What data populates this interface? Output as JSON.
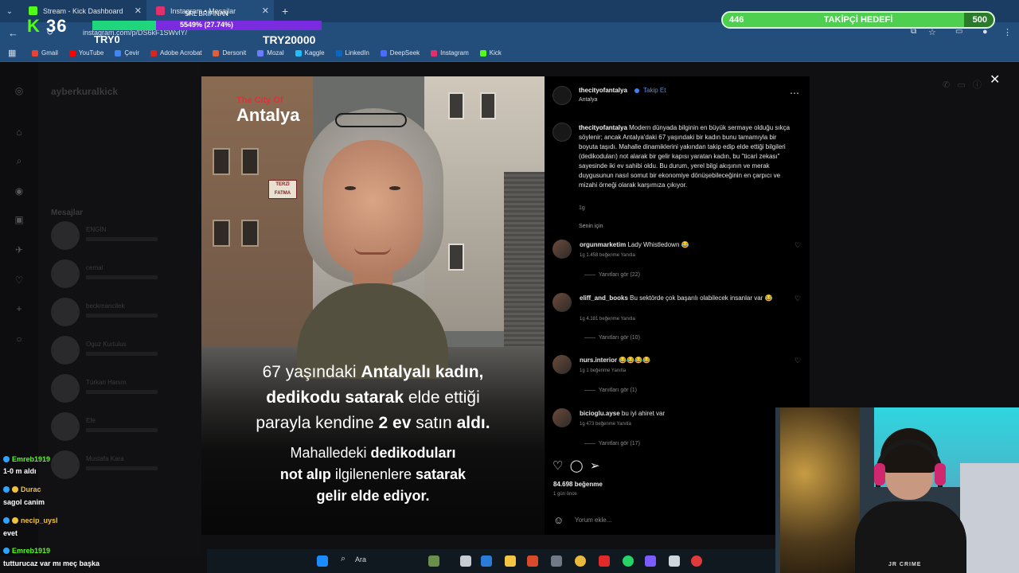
{
  "browser": {
    "tabs": [
      {
        "label": "Stream - Kick Dashboard",
        "icon": "kick-icon",
        "color": "#53fc18"
      },
      {
        "label": "Instagram • Mesajlar",
        "icon": "instagram-icon",
        "color": "#e1306c"
      }
    ],
    "url": "instagram.com/p/DS6kF1SWvlY/",
    "bookmarks": [
      {
        "label": "Gmail",
        "color": "#ea4335"
      },
      {
        "label": "YouTube",
        "color": "#ff0000"
      },
      {
        "label": "Çevir",
        "color": "#4285f4"
      },
      {
        "label": "Adobe Acrobat",
        "color": "#d7261f"
      },
      {
        "label": "Dersonit",
        "color": "#e35d3a"
      },
      {
        "label": "Mozal",
        "color": "#6b7cff"
      },
      {
        "label": "Kaggle",
        "color": "#20beff"
      },
      {
        "label": "LinkedIn",
        "color": "#0a66c2"
      },
      {
        "label": "DeepSeek",
        "color": "#4d6bfe"
      },
      {
        "label": "Instagram",
        "color": "#e1306c"
      },
      {
        "label": "Kick",
        "color": "#53fc18"
      }
    ]
  },
  "overlay": {
    "kick_count": "36",
    "try_label": "TRY0",
    "try_goal": "TRY20000",
    "progress_title": "SRL BRİFINAN",
    "progress_text": "5549% (27.74%)",
    "progress_fraction": 0.2774,
    "follower_goal": {
      "current": "446",
      "label": "TAKİPÇİ HEDEFİ",
      "target": "500",
      "fraction": 0.892
    }
  },
  "dm_panel": {
    "username": "ayberkuralkick",
    "section": "Mesajlar",
    "rows": [
      "ENGİN",
      "cemal",
      "beckmancilek",
      "Oguz Kurtulus",
      "Türkan Hanım",
      "Efe",
      "Mustafa Kara"
    ]
  },
  "post": {
    "brand_small": "The City Of",
    "brand_name": "Antalya",
    "sign_red": "",
    "sign_white": "TERZİ FATMA",
    "caption": {
      "l1a": "67 yaşındaki ",
      "l1b": "Antalyalı kadın,",
      "l2a": "dedikodu satarak",
      "l2b": " elde ettiği",
      "l3a": "parayla kendine ",
      "l3b": "2 ev",
      "l3c": " satın ",
      "l3d": "aldı.",
      "l4a": "Mahalledeki ",
      "l4b": "dedikoduları",
      "l5a": "not alıp",
      "l5b": " ilgilenenlere ",
      "l5c": "satarak",
      "l6": "gelir elde ediyor."
    }
  },
  "panel": {
    "account": "thecityofantalya",
    "follow": "Takip Et",
    "location": "Antalya",
    "caption_user": "thecityofantalya",
    "caption_text": "Modern dünyada bilginin en büyük sermaye olduğu sıkça söylenir; ancak Antalya'daki 67 yaşındaki bir kadın bunu tamamıyla bir boyuta taşıdı. Mahalle dinamiklerini yakından takip edip elde ettiği bilgileri (dedikoduları) not alarak bir gelir kapısı yaratan kadın, bu \"ticari zekası\" sayesinde iki ev sahibi oldu. Bu durum, yerel bilgi akışının ve merak duygusunun nasıl somut bir ekonomiye dönüşebileceğinin en çarpıcı ve mizahi örneği olarak karşımıza çıkıyor.",
    "caption_time": "1g",
    "seen": "Senin için",
    "comments": [
      {
        "user": "orgunmarketim",
        "text": "Lady Whistledown 😂",
        "meta": "1g   1.458 beğenme   Yanıtla",
        "replies": "Yanıtları gör (22)"
      },
      {
        "user": "eliff_and_books",
        "text": "Bu sektörde çok başarılı olabilecek insanlar var 😂",
        "meta": "1g   4.181 beğenme   Yanıtla",
        "replies": "Yanıtları gör (10)"
      },
      {
        "user": "nurs.interior",
        "text": "😂😂😂😂",
        "meta": "1g   1 beğenme   Yanıtla",
        "replies": "Yanıtları gör (1)"
      },
      {
        "user": "bicioglu.ayse",
        "text": "bu iyi ahiret var",
        "meta": "1g   473 beğenme   Yanıtla",
        "replies": "Yanıtları gör (17)"
      }
    ],
    "likes": "84.698 beğenme",
    "date": "1 gün önce",
    "add_comment": "Yorum ekle..."
  },
  "webcam": {
    "logo": "JR CRIME"
  },
  "chat": [
    {
      "name": "Emreb1919",
      "msg": "1-0 m aldı",
      "color": "#53fc18"
    },
    {
      "name": "Durac",
      "msg": "sagol canim",
      "color": "#f0c23a"
    },
    {
      "name": "necip_uysl",
      "msg": "evet",
      "color": "#f0c23a"
    },
    {
      "name": "Emreb1919",
      "msg": "tutturucaz var mı meç başka",
      "color": "#53fc18"
    }
  ],
  "taskbar": {
    "search": "Ara"
  }
}
